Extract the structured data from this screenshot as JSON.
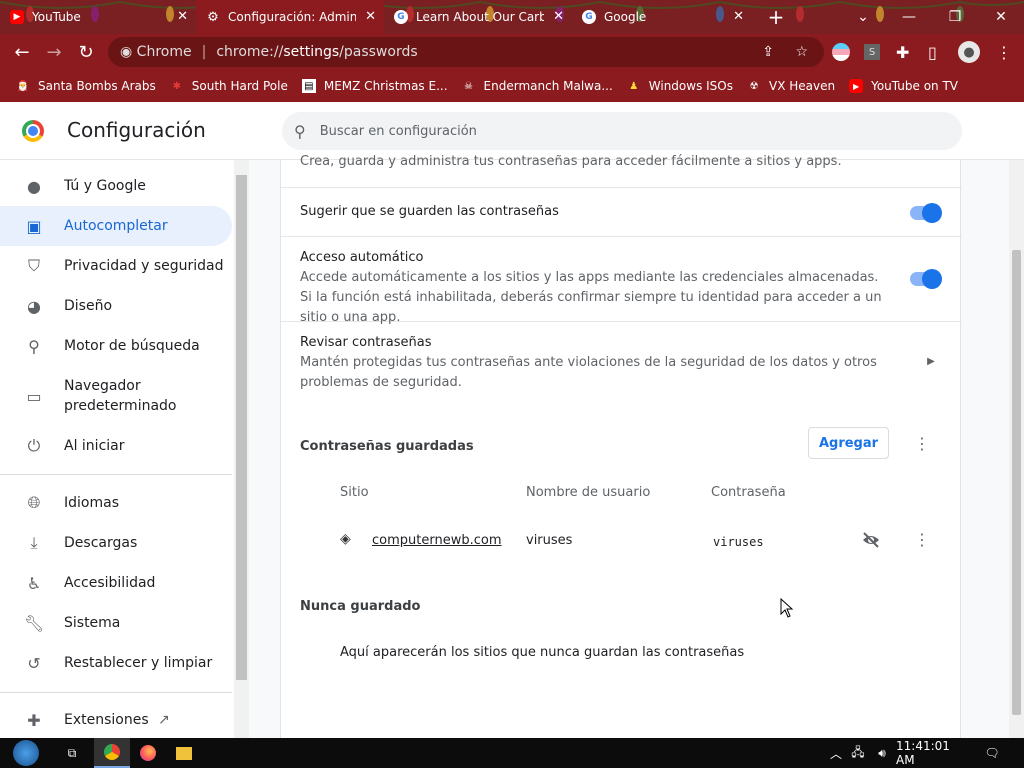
{
  "tabs": [
    {
      "title": "YouTube",
      "icon": "youtube-icon"
    },
    {
      "title": "Configuración: Admini",
      "icon": "gear-icon"
    },
    {
      "title": "Learn About Our Carb",
      "icon": "google-icon"
    },
    {
      "title": "Google",
      "icon": "google-icon"
    }
  ],
  "omnibox": {
    "chip": "Chrome",
    "url_prefix": "chrome://",
    "url_host": "settings",
    "url_path": "/passwords"
  },
  "bookmarks": [
    "Santa Bombs Arabs",
    "South Hard Pole",
    "MEMZ Christmas E...",
    "Endermanch Malwa...",
    "Windows ISOs",
    "VX Heaven",
    "YouTube on TV"
  ],
  "header": {
    "title": "Configuración",
    "search_placeholder": "Buscar en configuración"
  },
  "sidebar": {
    "items": [
      {
        "label": "Tú y Google",
        "icon": "person-icon"
      },
      {
        "label": "Autocompletar",
        "icon": "clipboard-icon"
      },
      {
        "label": "Privacidad y seguridad",
        "icon": "shield-icon"
      },
      {
        "label": "Diseño",
        "icon": "palette-icon"
      },
      {
        "label": "Motor de búsqueda",
        "icon": "search-icon"
      },
      {
        "label": "Navegador predeterminado",
        "icon": "browser-icon"
      },
      {
        "label": "Al iniciar",
        "icon": "power-icon"
      },
      {
        "label": "Idiomas",
        "icon": "globe-icon"
      },
      {
        "label": "Descargas",
        "icon": "download-icon"
      },
      {
        "label": "Accesibilidad",
        "icon": "accessibility-icon"
      },
      {
        "label": "Sistema",
        "icon": "wrench-icon"
      },
      {
        "label": "Restablecer y limpiar",
        "icon": "restore-icon"
      },
      {
        "label": "Extensiones",
        "icon": "puzzle-icon"
      }
    ]
  },
  "main": {
    "intro": "Crea, guarda y administra tus contraseñas para acceder fácilmente a sitios y apps.",
    "offer_save": "Sugerir que se guarden las contraseñas",
    "auto_signin_title": "Acceso automático",
    "auto_signin_desc": "Accede automáticamente a los sitios y las apps mediante las credenciales almacenadas. Si la función está inhabilitada, deberás confirmar siempre tu identidad para acceder a un sitio o una app.",
    "check_title": "Revisar contraseñas",
    "check_desc": "Mantén protegidas tus contraseñas ante violaciones de la seguridad de los datos y otros problemas de seguridad.",
    "saved_title": "Contraseñas guardadas",
    "add_button": "Agregar",
    "columns": [
      "Sitio",
      "Nombre de usuario",
      "Contraseña"
    ],
    "passwords": [
      {
        "site": "computernewb.com",
        "username": "viruses",
        "password": "viruses"
      }
    ],
    "never_title": "Nunca guardado",
    "never_empty": "Aquí aparecerán los sitios que nunca guardan las contraseñas"
  },
  "taskbar": {
    "time": "11:41:01 AM"
  }
}
